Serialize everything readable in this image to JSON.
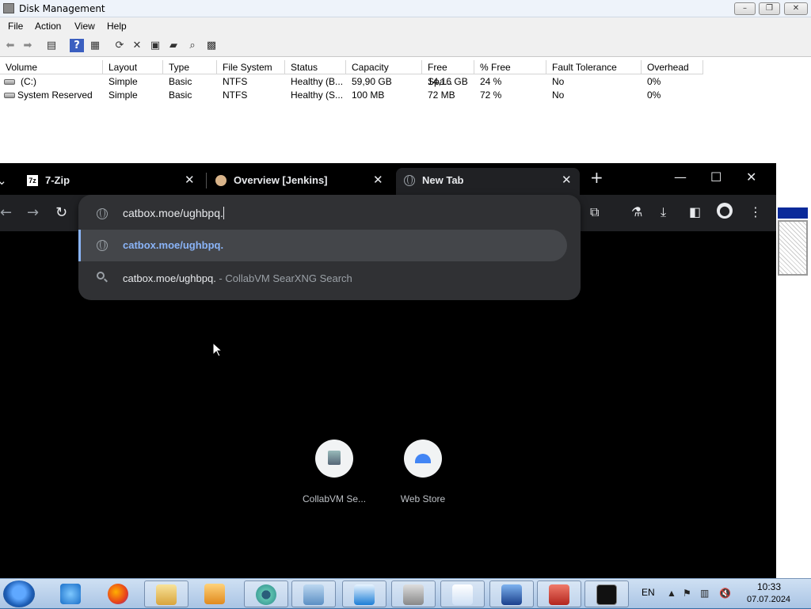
{
  "disk_management": {
    "title": "Disk Management",
    "menu": [
      "File",
      "Action",
      "View",
      "Help"
    ],
    "columns": [
      "Volume",
      "Layout",
      "Type",
      "File System",
      "Status",
      "Capacity",
      "Free Spa...",
      "% Free",
      "Fault Tolerance",
      "Overhead"
    ],
    "rows": [
      [
        "(C:)",
        "Simple",
        "Basic",
        "NTFS",
        "Healthy (B...",
        "59,90 GB",
        "14,16 GB",
        "24 %",
        "No",
        "0%"
      ],
      [
        "System Reserved",
        "Simple",
        "Basic",
        "NTFS",
        "Healthy (S...",
        "100 MB",
        "72 MB",
        "72 %",
        "No",
        "0%"
      ]
    ]
  },
  "chrome": {
    "tabs": [
      {
        "label": "7-Zip",
        "icon": "7zip-icon"
      },
      {
        "label": "Overview [Jenkins]",
        "icon": "jenkins-icon"
      },
      {
        "label": "New Tab",
        "icon": "globe-icon",
        "active": true
      }
    ],
    "new_tab_symbol": "+",
    "omnibox": {
      "value": "catbox.moe/ughbpq.",
      "suggestions": [
        {
          "text": "catbox.moe/ughbpq.",
          "icon": "globe-icon",
          "selected": true
        },
        {
          "text": "catbox.moe/ughbpq.",
          "suffix": " - CollabVM SearXNG Search",
          "icon": "search-icon"
        }
      ]
    },
    "shortcuts": [
      {
        "label": "CollabVM Se...",
        "icon": "collabvm-icon"
      },
      {
        "label": "Web Store",
        "icon": "webstore-icon"
      }
    ]
  },
  "taskbar": {
    "items": [
      "internet-explorer-icon",
      "firefox-icon",
      "file-explorer-icon",
      "media-player-icon",
      "chromium-icon",
      "computer-management-icon",
      "remote-desktop-icon",
      "disk-tool-icon",
      "document-icon",
      "network-icon",
      "toolbox-icon",
      "cmd-icon"
    ],
    "language": "EN",
    "time": "10:33",
    "date": "07.07.2024"
  }
}
